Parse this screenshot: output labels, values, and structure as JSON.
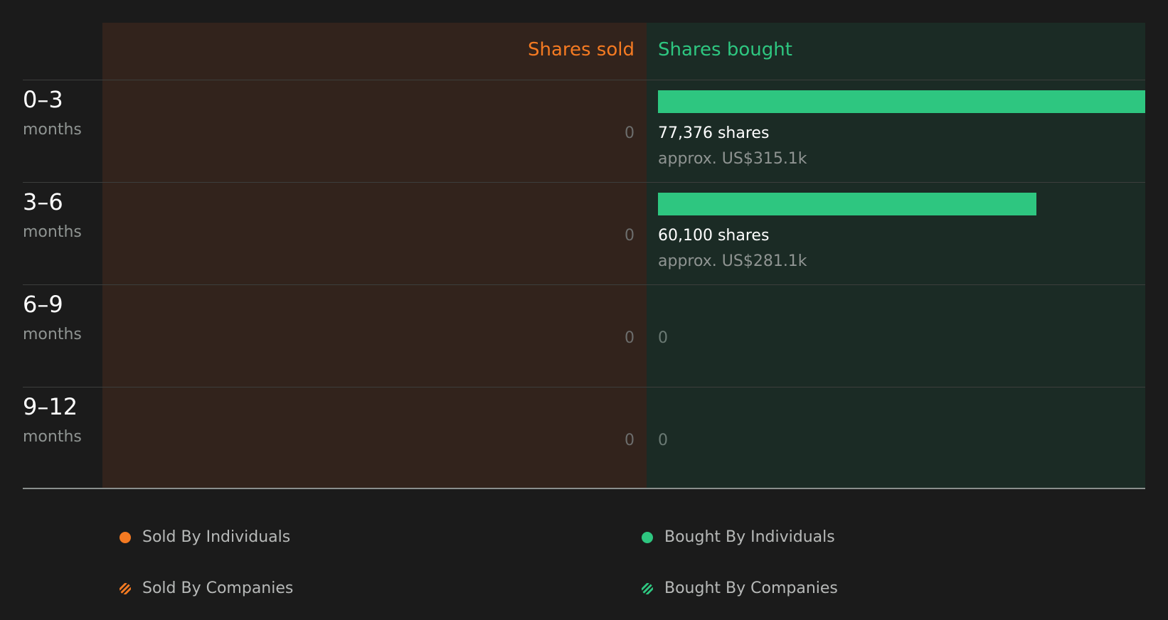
{
  "chart_data": {
    "type": "bar",
    "headers": {
      "sold": "Shares sold",
      "bought": "Shares bought"
    },
    "categories": [
      {
        "range": "0–3",
        "unit": "months"
      },
      {
        "range": "3–6",
        "unit": "months"
      },
      {
        "range": "6–9",
        "unit": "months"
      },
      {
        "range": "9–12",
        "unit": "months"
      }
    ],
    "sold_values": [
      0,
      0,
      0,
      0
    ],
    "bought_values": [
      77376,
      60100,
      0,
      0
    ],
    "sold_labels": [
      "0",
      "0",
      "0",
      "0"
    ],
    "bought_labels": [
      "77,376 shares",
      "60,100 shares",
      "0",
      "0"
    ],
    "bought_value_labels": [
      "approx. US$315.1k",
      "approx. US$281.1k",
      "",
      ""
    ],
    "legend": [
      {
        "label": "Sold By Individuals",
        "color": "#f47a22",
        "style": "solid"
      },
      {
        "label": "Bought By Individuals",
        "color": "#2ec680",
        "style": "solid"
      },
      {
        "label": "Sold By Companies",
        "color": "#f47a22",
        "style": "hatched"
      },
      {
        "label": "Bought By Companies",
        "color": "#2ec680",
        "style": "hatched"
      }
    ],
    "colors": {
      "sold": "#f47a22",
      "bought": "#2ec680",
      "sold_panel": "#32231c",
      "bought_panel": "#1b2b25",
      "background": "#1b1b1b"
    }
  }
}
